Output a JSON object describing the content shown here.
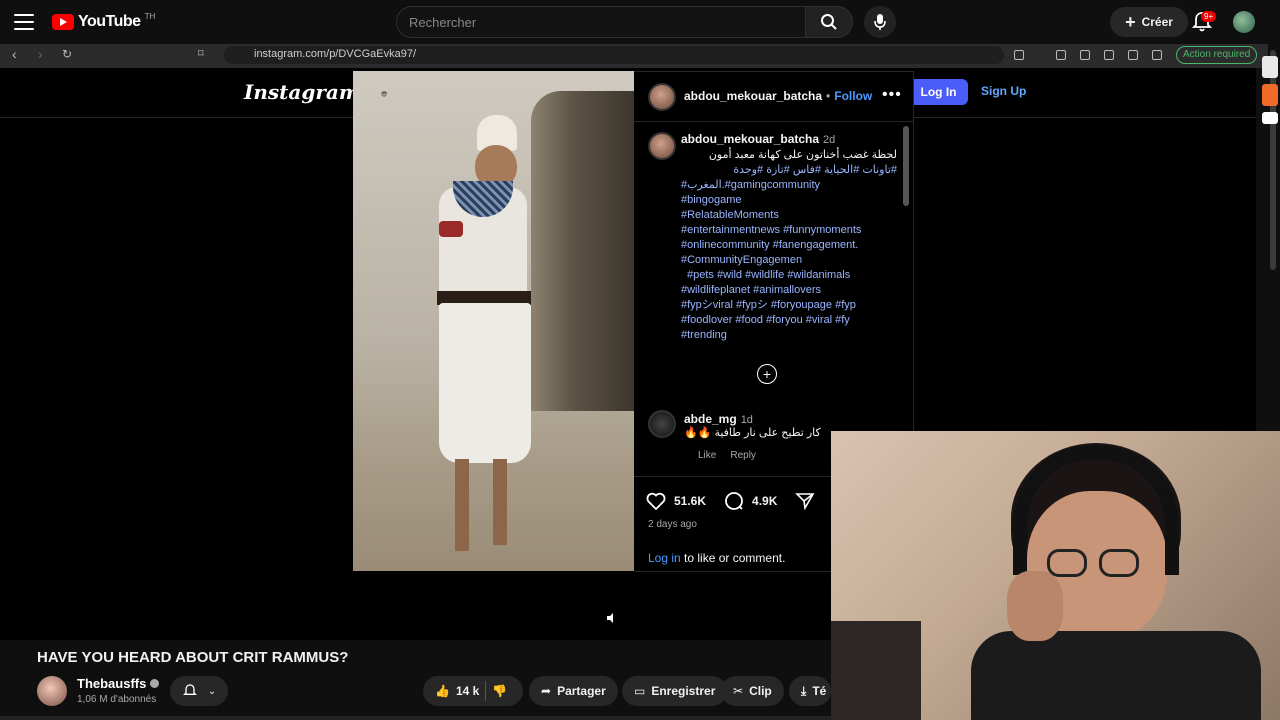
{
  "youtube": {
    "logo_text": "YouTube",
    "logo_region": "TH",
    "search_placeholder": "Rechercher",
    "create_label": "Créer",
    "notif_count": "9+"
  },
  "browser": {
    "url": "instagram.com/p/DVCGaEvka97/",
    "action_required": "Action required"
  },
  "instagram": {
    "logo": "Instagram",
    "login_label": "Log In",
    "signup_label": "Sign Up",
    "post": {
      "username": "abdou_mekouar_batcha",
      "follow_label": "Follow",
      "caption_user": "abdou_mekouar_batcha",
      "caption_time": "2d",
      "caption_arabic": "لحظة غضب أخناتون على كهانة معبد أمون",
      "caption_tags_line1": "#تاونات #الحياية #فاس #تازة #وجدة",
      "caption_tags_line2": "#المغرب.#gamingcommunity",
      "caption_tags_line3": "#bingogame",
      "caption_tags_line4": "#RelatableMoments",
      "caption_tags_line5": "#entertainmentnews #funnymoments",
      "caption_tags_line6": "#onlinecommunity #fanengagement.",
      "caption_tags_line7": "#CommunityEngagemen",
      "caption_tags_line8": "#pets #wild #wildlife #wildanimals",
      "caption_tags_line9": "#wildlifeplanet #animallovers",
      "caption_tags_line10": "#fypシviral #fypシ #foryoupage #fyp",
      "caption_tags_line11": "#foodlover #food #foryou #viral #fy",
      "caption_tags_line12": "#trending",
      "comment_user": "abde_mg",
      "comment_time": "1d",
      "comment_text": "كار تطيح على نار طافية 🔥🔥",
      "comment_like": "Like",
      "comment_reply": "Reply",
      "likes": "51.6K",
      "comments": "4.9K",
      "posted": "2 days ago",
      "login_link": "Log in",
      "login_suffix": " to like or comment."
    }
  },
  "video": {
    "title": "HAVE YOU HEARD ABOUT CRIT RAMMUS?",
    "channel": "Thebausffs",
    "subscribers": "1,06 M d'abonnés",
    "likes": "14 k",
    "share_label": "Partager",
    "save_label": "Enregistrer",
    "clip_label": "Clip",
    "download_label": "Té"
  }
}
